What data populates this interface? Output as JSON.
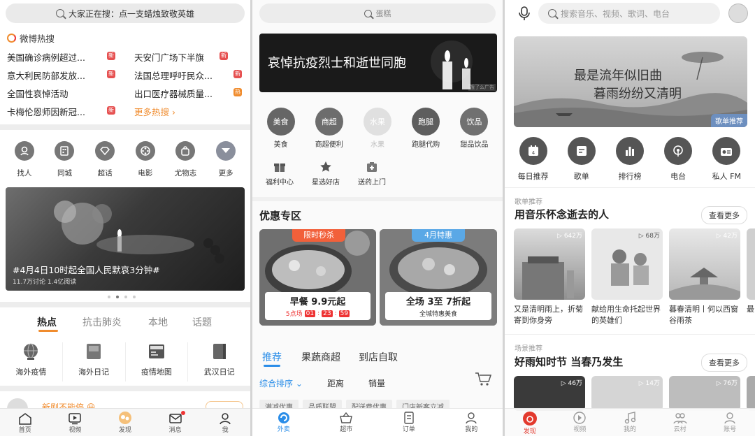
{
  "weibo": {
    "search_placeholder": "大家正在搜：点一支蜡烛致敬英雄",
    "hot_title": "微博热搜",
    "hot_left": [
      "美国确诊病例超过...",
      "意大利民防部发放...",
      "全国性哀悼活动",
      "卡梅伦恩师因新冠..."
    ],
    "hot_right": [
      "天安门广场下半旗",
      "法国总理呼吁民众...",
      "出口医疗器械质量...",
      "更多热搜"
    ],
    "badge_new": "新",
    "badge_hot": "热",
    "icons": [
      {
        "label": "找人",
        "icon": "person-search-icon"
      },
      {
        "label": "同城",
        "icon": "city-icon"
      },
      {
        "label": "超话",
        "icon": "diamond-icon"
      },
      {
        "label": "电影",
        "icon": "film-reel-icon"
      },
      {
        "label": "尤物志",
        "icon": "shopping-bag-icon"
      },
      {
        "label": "更多",
        "icon": "chevron-down-icon"
      }
    ],
    "banner_title": "#4月4日10时起全国人民默哀3分钟#",
    "banner_stats": "11.7万讨论  1.4亿阅读",
    "tabs": [
      "热点",
      "抗击肺炎",
      "本地",
      "话题"
    ],
    "grid": [
      {
        "label": "海外疫情",
        "icon": "globe-icon"
      },
      {
        "label": "海外日记",
        "icon": "diary-icon"
      },
      {
        "label": "疫情地图",
        "icon": "news-map-icon"
      },
      {
        "label": "武汉日记",
        "icon": "book-icon"
      }
    ],
    "teaser": "新剧不能停 😀",
    "nav": [
      "首页",
      "视频",
      "发现",
      "消息",
      "我"
    ]
  },
  "waimai": {
    "search_placeholder": "蛋糕",
    "banner_title": "哀悼抗疫烈士和逝世同胞",
    "banner_tag": "饿了么广告",
    "categories": [
      {
        "label": "美食",
        "circle": "美食"
      },
      {
        "label": "商超便利",
        "circle": "商超"
      },
      {
        "label": "水果",
        "circle": "水果"
      },
      {
        "label": "跑腿代购",
        "circle": "跑腿"
      },
      {
        "label": "甜品饮品",
        "circle": "饮品"
      }
    ],
    "small": [
      {
        "label": "福利中心",
        "icon": "gift-icon"
      },
      {
        "label": "星选好店",
        "icon": "star-icon"
      },
      {
        "label": "送药上门",
        "icon": "medicine-box-icon"
      }
    ],
    "deals_title": "优惠专区",
    "deal1": {
      "tag": "限时秒杀",
      "title": "早餐 9.9元起",
      "sub": "5点场",
      "time": [
        "01",
        "23",
        "59"
      ]
    },
    "deal2": {
      "tag": "4月特惠",
      "title": "全场 3至 7折起",
      "sub": "全城特惠美食"
    },
    "tabs": [
      "推荐",
      "果蔬商超",
      "到店自取"
    ],
    "filters": [
      "综合排序",
      "距离",
      "销量"
    ],
    "chips": [
      "满减优惠",
      "品质联盟",
      "配送费优惠",
      "门店新客立减"
    ],
    "nav": [
      "外卖",
      "超市",
      "订单",
      "我的"
    ]
  },
  "music": {
    "search_placeholder": "搜索音乐、视频、歌词、电台",
    "banner_line1": "最是流年似旧曲",
    "banner_line2": "暮雨纷纷又清明",
    "banner_tag": "歌单推荐",
    "menu": [
      {
        "label": "每日推荐",
        "icon": "calendar-icon",
        "num": "4"
      },
      {
        "label": "歌单",
        "icon": "playlist-icon"
      },
      {
        "label": "排行榜",
        "icon": "chart-bars-icon"
      },
      {
        "label": "电台",
        "icon": "radio-icon"
      },
      {
        "label": "私人 FM",
        "icon": "fm-radio-icon"
      }
    ],
    "sec1_small": "歌单推荐",
    "sec1_title": "用音乐怀念逝去的人",
    "more": "查看更多",
    "cards1": [
      {
        "plays": "642万",
        "text": "又是清明雨上，折菊寄到你身旁"
      },
      {
        "plays": "68万",
        "text": "献给用生命托起世界的英雄们"
      },
      {
        "plays": "42万",
        "text": "暮春清明丨何以西窗谷雨茶"
      }
    ],
    "cards1_extra": "最",
    "sec2_small": "场景推荐",
    "sec2_title": "好雨知时节 当春乃发生",
    "cards2_plays": [
      "46万",
      "14万",
      "76万"
    ],
    "nav": [
      "发现",
      "视频",
      "我的",
      "云村",
      "账号"
    ]
  }
}
